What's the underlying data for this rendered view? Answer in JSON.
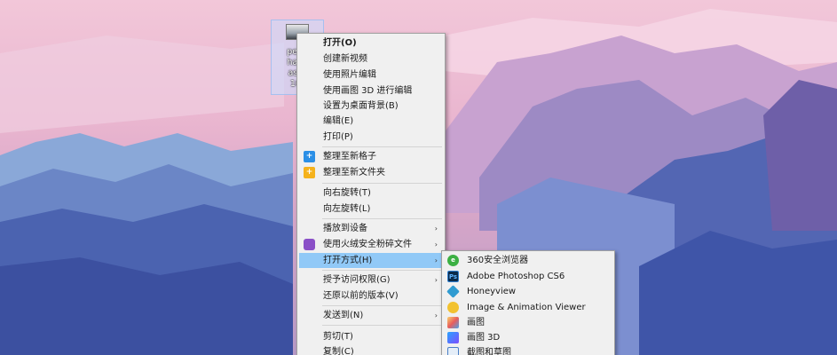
{
  "desktop": {
    "icon": {
      "lines": [
        "pexel",
        "hard-",
        "astei",
        "167"
      ]
    }
  },
  "main_menu": {
    "items": [
      {
        "label": "打开(O)",
        "bold": true
      },
      {
        "label": "创建新视频"
      },
      {
        "label": "使用照片编辑"
      },
      {
        "label": "使用画图 3D 进行编辑"
      },
      {
        "label": "设置为桌面背景(B)"
      },
      {
        "label": "编辑(E)"
      },
      {
        "label": "打印(P)"
      },
      {
        "label": "整理至新格子",
        "icon": "grid-add-icon"
      },
      {
        "label": "整理至新文件夹",
        "icon": "folder-add-icon"
      },
      {
        "label": "向右旋转(T)"
      },
      {
        "label": "向左旋转(L)"
      },
      {
        "label": "播放到设备",
        "submenu": true
      },
      {
        "label": "使用火绒安全粉碎文件",
        "icon": "huorong-shredder-icon",
        "submenu": true
      },
      {
        "label": "打开方式(H)",
        "submenu": true,
        "highlighted": true
      },
      {
        "label": "授予访问权限(G)",
        "submenu": true
      },
      {
        "label": "还原以前的版本(V)"
      },
      {
        "label": "发送到(N)",
        "submenu": true
      },
      {
        "label": "剪切(T)"
      },
      {
        "label": "复制(C)"
      }
    ]
  },
  "open_with_menu": {
    "items": [
      {
        "label": "360安全浏览器",
        "icon": "360-browser-icon"
      },
      {
        "label": "Adobe Photoshop CS6",
        "icon": "photoshop-icon",
        "icon_text": "Ps"
      },
      {
        "label": "Honeyview",
        "icon": "honeyview-icon"
      },
      {
        "label": "Image & Animation Viewer",
        "icon": "image-viewer-icon"
      },
      {
        "label": "画图",
        "icon": "paint-icon"
      },
      {
        "label": "画图 3D",
        "icon": "paint-3d-icon"
      },
      {
        "label": "截图和草图",
        "icon": "snip-sketch-icon"
      }
    ]
  },
  "glyphs": {
    "arrow": "›",
    "plus": "+",
    "ps": "Ps",
    "e": "e"
  },
  "colors": {
    "highlight": "#91c9f7",
    "menu_bg": "#f0f0f0"
  }
}
